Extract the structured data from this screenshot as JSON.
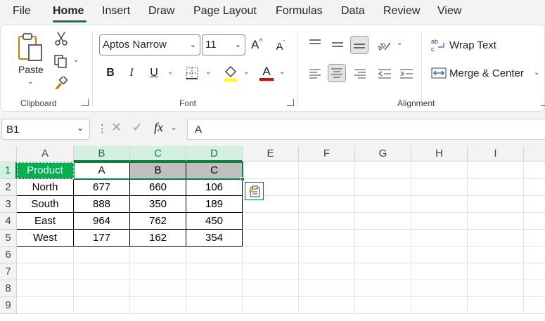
{
  "menu": {
    "tabs": [
      "File",
      "Home",
      "Insert",
      "Draw",
      "Page Layout",
      "Formulas",
      "Data",
      "Review",
      "View"
    ],
    "active": "Home"
  },
  "ribbon": {
    "clipboard": {
      "paste_label": "Paste",
      "group_label": "Clipboard"
    },
    "font": {
      "font_name": "Aptos Narrow",
      "font_size": "11",
      "bold": "B",
      "italic": "I",
      "underline": "U",
      "font_color_glyph": "A",
      "group_label": "Font",
      "highlight_color": "#ffff00",
      "font_color": "#e00000"
    },
    "alignment": {
      "wrap_text_label": "Wrap Text",
      "merge_label": "Merge & Center",
      "group_label": "Alignment"
    }
  },
  "formula_bar": {
    "name_box": "B1",
    "fx_label": "fx",
    "content": "A"
  },
  "grid": {
    "columns": [
      "A",
      "B",
      "C",
      "D",
      "E",
      "F",
      "G",
      "H",
      "I"
    ],
    "rows": [
      "1",
      "2",
      "3",
      "4",
      "5",
      "6",
      "7",
      "8",
      "9"
    ],
    "data": [
      [
        "Product",
        "A",
        "B",
        "C"
      ],
      [
        "North",
        "677",
        "660",
        "106"
      ],
      [
        "South",
        "888",
        "350",
        "189"
      ],
      [
        "East",
        "964",
        "762",
        "450"
      ],
      [
        "West",
        "177",
        "162",
        "354"
      ]
    ],
    "header_fill": "#00b050",
    "gray_fill": "#bfbfbf",
    "accent": "#107c41"
  }
}
